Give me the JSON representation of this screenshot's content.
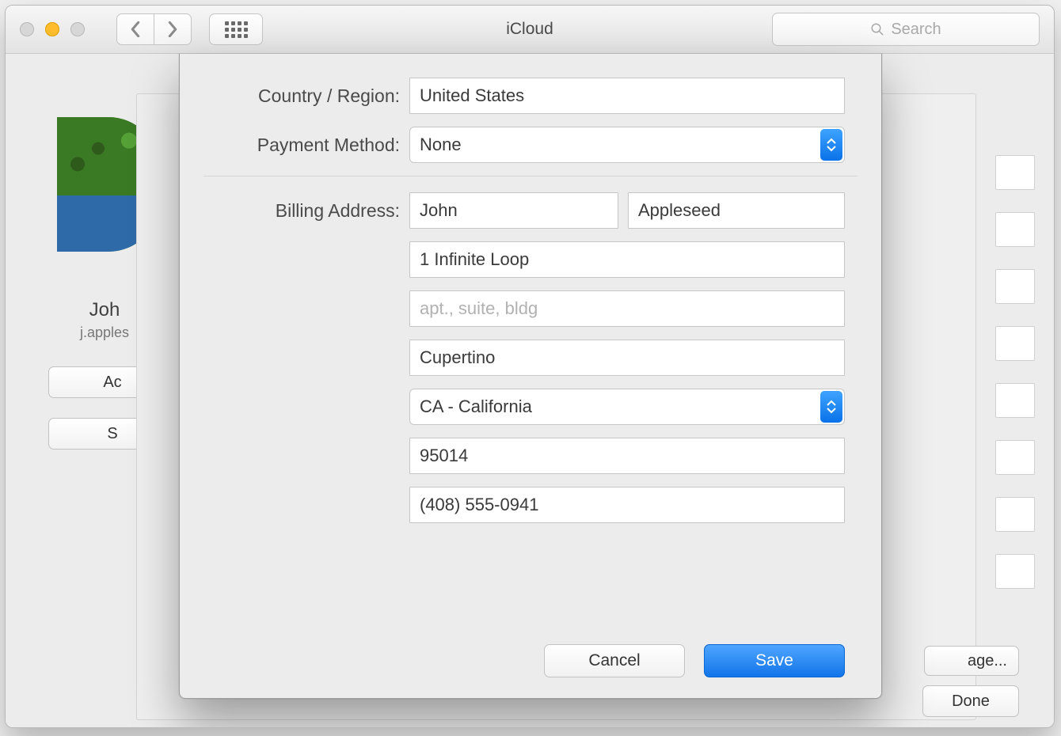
{
  "window": {
    "title": "iCloud",
    "search_placeholder": "Search"
  },
  "bg": {
    "user_name": "Joh",
    "user_email": "j.apples",
    "side_button_ac": "Ac",
    "side_button_s": "S",
    "done_label": "Done",
    "age_label": "age..."
  },
  "sheet": {
    "labels": {
      "country_region": "Country / Region:",
      "payment_method": "Payment Method:",
      "billing_address": "Billing Address:"
    },
    "country_region": "United States",
    "payment_method": "None",
    "first_name": "John",
    "last_name": "Appleseed",
    "street": "1 Infinite Loop",
    "apt_placeholder": "apt., suite, bldg",
    "city": "Cupertino",
    "state": "CA - California",
    "zip": "95014",
    "phone": "(408) 555-0941",
    "cancel_label": "Cancel",
    "save_label": "Save"
  }
}
